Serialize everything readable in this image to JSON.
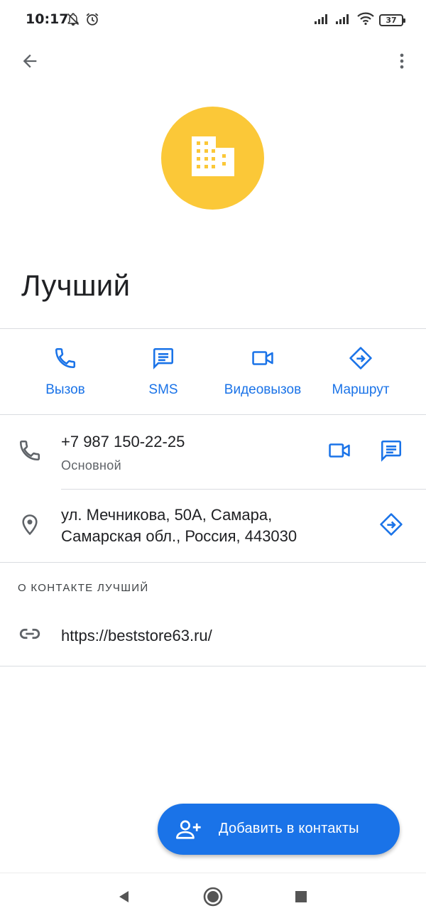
{
  "status_bar": {
    "time": "10:17",
    "left_icons": [
      "notifications-off-icon",
      "alarm-icon"
    ],
    "right_icons": [
      "signal-icon",
      "signal-icon",
      "wifi-icon",
      "battery-icon"
    ],
    "battery_level": "37"
  },
  "top_bar": {
    "back_icon": "arrow-back-icon",
    "more_icon": "more-vert-icon"
  },
  "contact": {
    "avatar_icon": "business-icon",
    "avatar_color": "#fbc838",
    "name": "Лучший"
  },
  "actions": [
    {
      "label": "Вызов",
      "icon": "phone-icon"
    },
    {
      "label": "SMS",
      "icon": "message-icon"
    },
    {
      "label": "Видеовызов",
      "icon": "videocam-icon"
    },
    {
      "label": "Маршрут",
      "icon": "directions-icon"
    }
  ],
  "phone": {
    "number": "+7 987 150-22-25",
    "type": "Основной"
  },
  "address": {
    "line1": "ул. Мечникова, 50А, Самара,",
    "line2": "Самарская обл., Россия, 443030"
  },
  "about": {
    "header": "О КОНТАКТЕ ЛУЧШИЙ",
    "website": "https://beststore63.ru/"
  },
  "fab": {
    "label": "Добавить в контакты",
    "icon": "person-add-icon"
  },
  "nav_bar": {
    "items": [
      "back-triangle-icon",
      "home-circle-icon",
      "recents-square-icon"
    ]
  },
  "colors": {
    "accent": "#1a73e8",
    "icon_gray": "#5f6368",
    "divider": "#dadce0"
  }
}
